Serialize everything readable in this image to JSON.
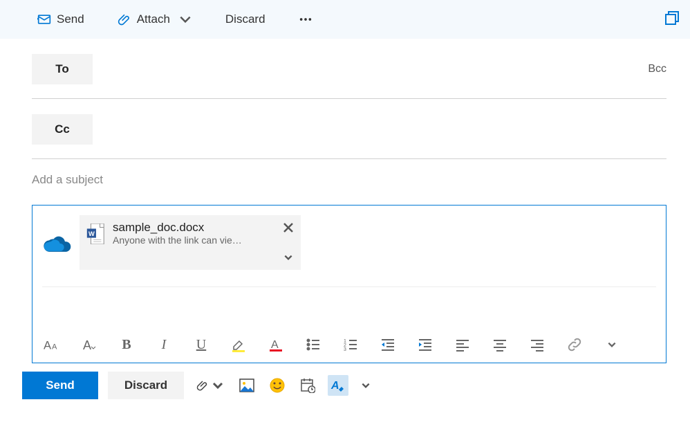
{
  "toolbar": {
    "send_label": "Send",
    "attach_label": "Attach",
    "discard_label": "Discard"
  },
  "fields": {
    "to_label": "To",
    "cc_label": "Cc",
    "bcc_label": "Bcc",
    "subject_placeholder": "Add a subject"
  },
  "attachment": {
    "filename": "sample_doc.docx",
    "permission_text": "Anyone with the link can view and ..."
  },
  "bottom": {
    "send_label": "Send",
    "discard_label": "Discard"
  }
}
